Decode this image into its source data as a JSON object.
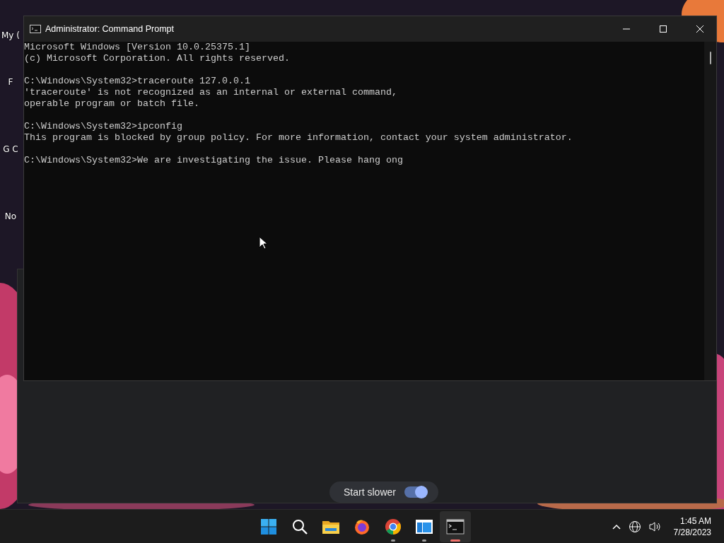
{
  "desktop": {
    "icons": [
      {
        "label": "My ("
      },
      {
        "label": "F"
      },
      {
        "label": "G C"
      },
      {
        "label": "No"
      }
    ]
  },
  "console_window": {
    "title": "Administrator: Command Prompt",
    "blocks": [
      [
        "Microsoft Windows [Version 10.0.25375.1]",
        "(c) Microsoft Corporation. All rights reserved."
      ],
      [
        "C:\\Windows\\System32>traceroute 127.0.0.1",
        "'traceroute' is not recognized as an internal or external command,",
        "operable program or batch file."
      ],
      [
        "C:\\Windows\\System32>ipconfig",
        "This program is blocked by group policy. For more information, contact your system administrator."
      ],
      [
        "C:\\Windows\\System32>We are investigating the issue. Please hang ong"
      ]
    ]
  },
  "start_slower": {
    "label": "Start slower",
    "on": true
  },
  "taskbar": {
    "apps": [
      {
        "kind": "start",
        "running": false,
        "active": false
      },
      {
        "kind": "search",
        "running": false,
        "active": false
      },
      {
        "kind": "folder",
        "running": false,
        "active": false
      },
      {
        "kind": "firefox",
        "running": false,
        "active": false
      },
      {
        "kind": "chrome",
        "running": true,
        "active": false
      },
      {
        "kind": "window",
        "running": true,
        "active": false
      },
      {
        "kind": "terminal",
        "running": true,
        "active": true
      }
    ],
    "time": "1:45 AM",
    "date": "7/28/2023"
  }
}
